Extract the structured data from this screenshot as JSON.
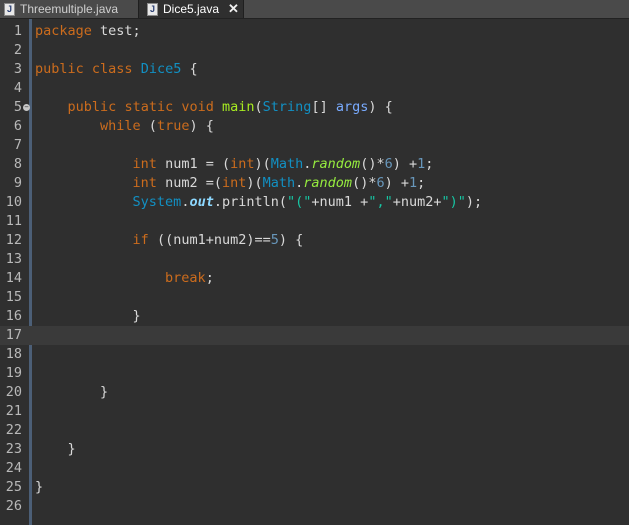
{
  "tabs": [
    {
      "name": "Threemultiple.java",
      "icon": "java-file-icon",
      "active": false
    },
    {
      "name": "Dice5.java",
      "icon": "java-file-icon",
      "active": true,
      "close_glyph": "✕"
    }
  ],
  "editor": {
    "current_line": 17,
    "lines": [
      {
        "n": "1",
        "tokens": [
          {
            "t": "package",
            "c": "kw"
          },
          {
            "t": " test;",
            "c": "txt"
          }
        ]
      },
      {
        "n": "2",
        "tokens": []
      },
      {
        "n": "3",
        "tokens": [
          {
            "t": "public",
            "c": "kw"
          },
          {
            "t": " ",
            "c": "txt"
          },
          {
            "t": "class",
            "c": "kw"
          },
          {
            "t": " ",
            "c": "txt"
          },
          {
            "t": "Dice5",
            "c": "cls"
          },
          {
            "t": " {",
            "c": "txt"
          }
        ]
      },
      {
        "n": "4",
        "tokens": []
      },
      {
        "n": "5",
        "fold": true,
        "tokens": [
          {
            "t": "    ",
            "c": "txt"
          },
          {
            "t": "public",
            "c": "kw"
          },
          {
            "t": " ",
            "c": "txt"
          },
          {
            "t": "static",
            "c": "kw"
          },
          {
            "t": " ",
            "c": "txt"
          },
          {
            "t": "void",
            "c": "kw"
          },
          {
            "t": " ",
            "c": "txt"
          },
          {
            "t": "main",
            "c": "mth"
          },
          {
            "t": "(",
            "c": "txt"
          },
          {
            "t": "String",
            "c": "cls"
          },
          {
            "t": "[] ",
            "c": "txt"
          },
          {
            "t": "args",
            "c": "arg"
          },
          {
            "t": ") {",
            "c": "txt"
          }
        ]
      },
      {
        "n": "6",
        "tokens": [
          {
            "t": "        ",
            "c": "txt"
          },
          {
            "t": "while",
            "c": "kw"
          },
          {
            "t": " (",
            "c": "txt"
          },
          {
            "t": "true",
            "c": "kw"
          },
          {
            "t": ") {",
            "c": "txt"
          }
        ]
      },
      {
        "n": "7",
        "tokens": []
      },
      {
        "n": "8",
        "tokens": [
          {
            "t": "            ",
            "c": "txt"
          },
          {
            "t": "int",
            "c": "kw"
          },
          {
            "t": " num1 = (",
            "c": "txt"
          },
          {
            "t": "int",
            "c": "kw"
          },
          {
            "t": ")(",
            "c": "txt"
          },
          {
            "t": "Math",
            "c": "cls"
          },
          {
            "t": ".",
            "c": "txt"
          },
          {
            "t": "random",
            "c": "rnd"
          },
          {
            "t": "()*",
            "c": "txt"
          },
          {
            "t": "6",
            "c": "num"
          },
          {
            "t": ") +",
            "c": "txt"
          },
          {
            "t": "1",
            "c": "num"
          },
          {
            "t": ";",
            "c": "txt"
          }
        ]
      },
      {
        "n": "9",
        "tokens": [
          {
            "t": "            ",
            "c": "txt"
          },
          {
            "t": "int",
            "c": "kw"
          },
          {
            "t": " num2 =(",
            "c": "txt"
          },
          {
            "t": "int",
            "c": "kw"
          },
          {
            "t": ")(",
            "c": "txt"
          },
          {
            "t": "Math",
            "c": "cls"
          },
          {
            "t": ".",
            "c": "txt"
          },
          {
            "t": "random",
            "c": "rnd"
          },
          {
            "t": "()*",
            "c": "txt"
          },
          {
            "t": "6",
            "c": "num"
          },
          {
            "t": ") +",
            "c": "txt"
          },
          {
            "t": "1",
            "c": "num"
          },
          {
            "t": ";",
            "c": "txt"
          }
        ]
      },
      {
        "n": "10",
        "tokens": [
          {
            "t": "            ",
            "c": "txt"
          },
          {
            "t": "System",
            "c": "sys"
          },
          {
            "t": ".",
            "c": "txt"
          },
          {
            "t": "out",
            "c": "out"
          },
          {
            "t": ".println(",
            "c": "txt"
          },
          {
            "t": "\"(\"",
            "c": "str"
          },
          {
            "t": "+num1 +",
            "c": "txt"
          },
          {
            "t": "\",\"",
            "c": "str"
          },
          {
            "t": "+num2+",
            "c": "txt"
          },
          {
            "t": "\")\"",
            "c": "str"
          },
          {
            "t": ");",
            "c": "txt"
          }
        ]
      },
      {
        "n": "11",
        "tokens": []
      },
      {
        "n": "12",
        "tokens": [
          {
            "t": "            ",
            "c": "txt"
          },
          {
            "t": "if",
            "c": "kw"
          },
          {
            "t": " ((num1+num2)==",
            "c": "txt"
          },
          {
            "t": "5",
            "c": "num"
          },
          {
            "t": ") {",
            "c": "txt"
          }
        ]
      },
      {
        "n": "13",
        "tokens": []
      },
      {
        "n": "14",
        "tokens": [
          {
            "t": "                ",
            "c": "txt"
          },
          {
            "t": "break",
            "c": "kw"
          },
          {
            "t": ";",
            "c": "txt"
          }
        ]
      },
      {
        "n": "15",
        "tokens": []
      },
      {
        "n": "16",
        "tokens": [
          {
            "t": "            }",
            "c": "txt"
          }
        ]
      },
      {
        "n": "17",
        "tokens": []
      },
      {
        "n": "18",
        "tokens": []
      },
      {
        "n": "19",
        "tokens": []
      },
      {
        "n": "20",
        "tokens": [
          {
            "t": "        }",
            "c": "txt"
          }
        ]
      },
      {
        "n": "21",
        "tokens": []
      },
      {
        "n": "22",
        "tokens": []
      },
      {
        "n": "23",
        "tokens": [
          {
            "t": "    }",
            "c": "txt"
          }
        ]
      },
      {
        "n": "24",
        "tokens": []
      },
      {
        "n": "25",
        "tokens": [
          {
            "t": "}",
            "c": "txt"
          }
        ]
      },
      {
        "n": "26",
        "tokens": []
      }
    ]
  }
}
